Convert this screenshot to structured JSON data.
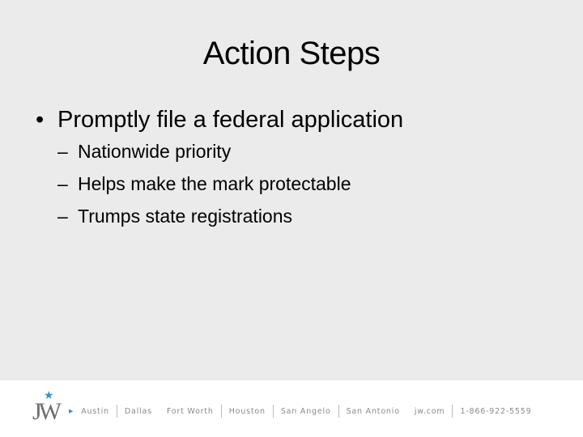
{
  "slide": {
    "title": "Action Steps",
    "bullets": [
      {
        "marker": "•",
        "text": "Promptly file a federal application",
        "sub": [
          {
            "marker": "–",
            "text": "Nationwide priority"
          },
          {
            "marker": "–",
            "text": "Helps make the mark protectable"
          },
          {
            "marker": "–",
            "text": "Trumps state registrations"
          }
        ]
      }
    ]
  },
  "footer": {
    "logo": {
      "text": "JW",
      "icon": "star-icon",
      "star_glyph": "★",
      "star_color": "#3d8fc6"
    },
    "arrow_glyph": "▶",
    "cities": [
      "Austin",
      "Dallas",
      "Fort Worth",
      "Houston",
      "San Angelo",
      "San Antonio"
    ],
    "website": "jw.com",
    "phone": "1-866-922-5559"
  }
}
